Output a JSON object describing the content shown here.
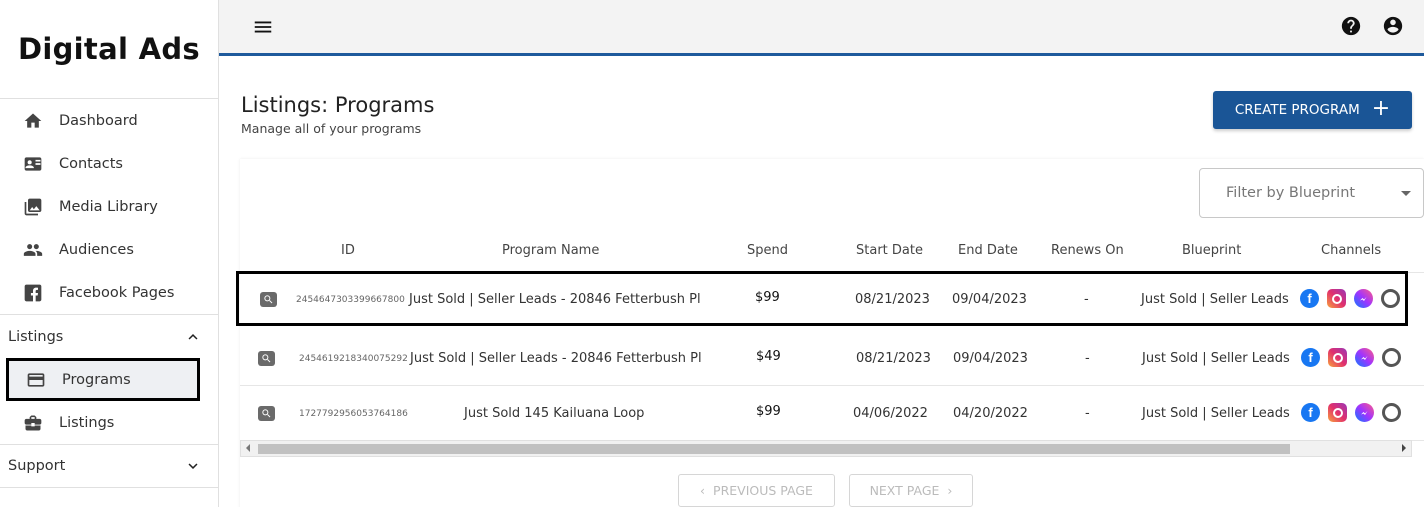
{
  "brand": "Digital Ads",
  "sidebar": {
    "items": [
      {
        "label": "Dashboard",
        "icon": "home-icon"
      },
      {
        "label": "Contacts",
        "icon": "contact-card-icon"
      },
      {
        "label": "Media Library",
        "icon": "photo-library-icon"
      },
      {
        "label": "Audiences",
        "icon": "people-icon"
      },
      {
        "label": "Facebook Pages",
        "icon": "facebook-icon"
      }
    ],
    "listings_section": "Listings",
    "listings_items": [
      {
        "label": "Programs",
        "icon": "card-icon",
        "active": true
      },
      {
        "label": "Listings",
        "icon": "briefcase-icon"
      }
    ],
    "support_section": "Support"
  },
  "topbar": {
    "menu_icon": "hamburger-menu-icon",
    "help_icon": "help-circle-icon",
    "account_icon": "account-circle-icon",
    "accent_color": "#1e5a9c"
  },
  "page": {
    "title": "Listings: Programs",
    "subtitle": "Manage all of your programs",
    "create_button": "CREATE PROGRAM",
    "create_button_plus": "+",
    "filter_placeholder": "Filter by Blueprint"
  },
  "table": {
    "headers": {
      "id": "ID",
      "name": "Program Name",
      "spend": "Spend",
      "start": "Start Date",
      "end": "End Date",
      "renews": "Renews On",
      "blueprint": "Blueprint",
      "channels": "Channels"
    },
    "rows": [
      {
        "id": "2454647303399667800",
        "name": "Just Sold | Seller Leads - 20846 Fetterbush Pl",
        "spend": "$99",
        "start": "08/21/2023",
        "end": "09/04/2023",
        "renews": "-",
        "blueprint": "Just Sold | Seller Leads"
      },
      {
        "id": "2454619218340075292",
        "name": "Just Sold | Seller Leads - 20846 Fetterbush Pl",
        "spend": "$49",
        "start": "08/21/2023",
        "end": "09/04/2023",
        "renews": "-",
        "blueprint": "Just Sold | Seller Leads"
      },
      {
        "id": "1727792956053764186",
        "name": "Just Sold 145 Kailuana Loop",
        "spend": "$99",
        "start": "04/06/2022",
        "end": "04/20/2022",
        "renews": "-",
        "blueprint": "Just Sold | Seller Leads"
      }
    ]
  },
  "pager": {
    "prev": "PREVIOUS PAGE",
    "next": "NEXT PAGE"
  }
}
